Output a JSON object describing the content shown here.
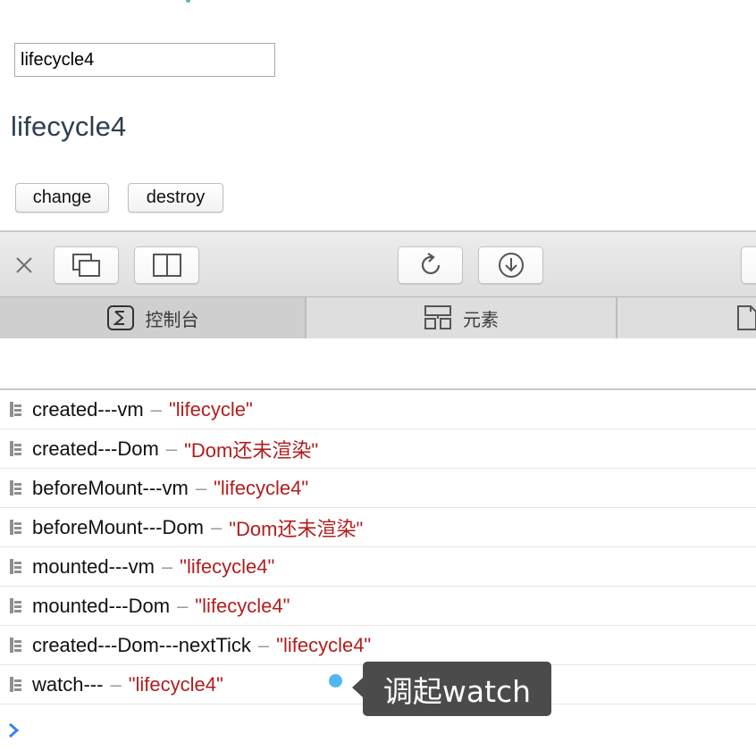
{
  "app": {
    "input_value": "lifecycle4",
    "heading": "lifecycle4",
    "buttons": {
      "change": "change",
      "destroy": "destroy"
    }
  },
  "toolbar": {
    "close_icon": "close-icon",
    "buttons": [
      "detach-window-icon",
      "split-view-icon",
      "reload-icon",
      "download-icon"
    ]
  },
  "tabs": [
    {
      "label": "控制台",
      "icon": "console-icon",
      "selected": true
    },
    {
      "label": "元素",
      "icon": "elements-icon",
      "selected": false
    },
    {
      "label": "",
      "icon": "resources-icon",
      "selected": false
    }
  ],
  "console": {
    "rows": [
      {
        "label": "created---vm",
        "sep": "–",
        "value": "\"lifecycle\""
      },
      {
        "label": "created---Dom",
        "sep": "–",
        "value": "\"Dom还未渲染\""
      },
      {
        "label": "beforeMount---vm",
        "sep": "–",
        "value": "\"lifecycle4\""
      },
      {
        "label": "beforeMount---Dom",
        "sep": "–",
        "value": "\"Dom还未渲染\""
      },
      {
        "label": "mounted---vm",
        "sep": "–",
        "value": "\"lifecycle4\""
      },
      {
        "label": "mounted---Dom",
        "sep": "–",
        "value": "\"lifecycle4\""
      },
      {
        "label": "created---Dom---nextTick",
        "sep": "–",
        "value": "\"lifecycle4\""
      },
      {
        "label": "watch---",
        "sep": "–",
        "value": "\"lifecycle4\""
      }
    ],
    "prompt_icon": "chevron-right-icon"
  },
  "tooltip": {
    "text": "调起watch"
  },
  "colors": {
    "console_value": "#b21d1d",
    "dot": "#4fb8f2",
    "heading": "#2c3e50",
    "prompt": "#3b82f6"
  }
}
